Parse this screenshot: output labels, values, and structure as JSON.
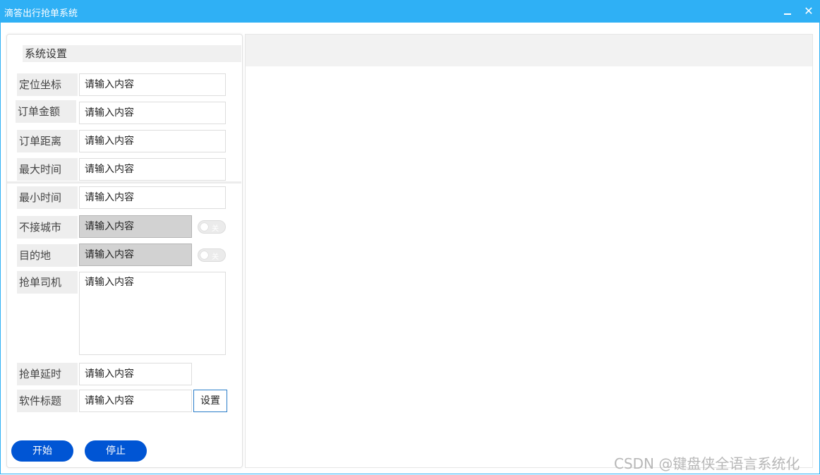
{
  "window": {
    "title": "滴答出行抢单系统",
    "close_glyph": "✕"
  },
  "settings": {
    "header": "系统设置",
    "fields": [
      {
        "label": "定位坐标",
        "placeholder": "请输入内容"
      },
      {
        "label": "订单金额",
        "placeholder": "请输入内容"
      },
      {
        "label": "订单距离",
        "placeholder": "请输入内容"
      },
      {
        "label": "最大时间",
        "placeholder": "请输入内容"
      },
      {
        "label": "最小时间",
        "placeholder": "请输入内容"
      },
      {
        "label": "不接城市",
        "placeholder": "请输入内容",
        "disabled": true
      },
      {
        "label": "目的地",
        "placeholder": "请输入内容",
        "disabled": true
      },
      {
        "label": "抢单司机",
        "placeholder": "请输入内容"
      },
      {
        "label": "抢单延时",
        "placeholder": "请输入内容"
      },
      {
        "label": "软件标题",
        "placeholder": "请输入内容"
      }
    ],
    "toggles": [
      {
        "label": "关",
        "on": false
      },
      {
        "label": "关",
        "on": false
      }
    ],
    "set_button": "设置"
  },
  "actions": {
    "start": "开始",
    "stop": "停止"
  },
  "watermark": "CSDN @键盘侠全语言系统化"
}
